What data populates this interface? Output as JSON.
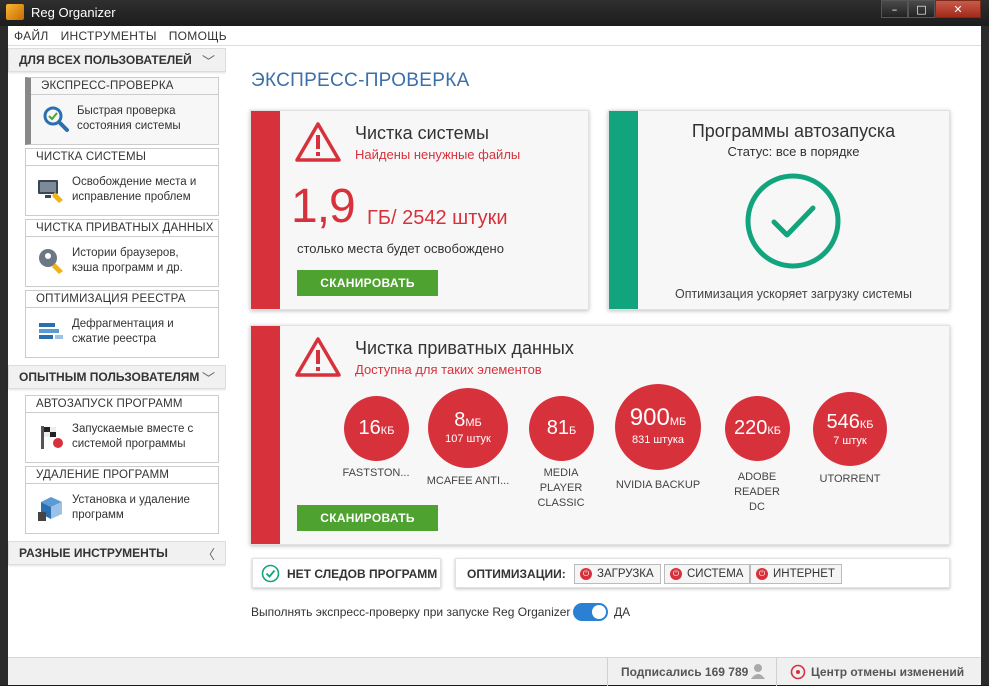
{
  "window": {
    "title": "Reg Organizer",
    "minimize": "–",
    "maximize": "□",
    "close": "✕"
  },
  "menu": [
    "ФАЙЛ",
    "ИНСТРУМЕНТЫ",
    "ПОМОЩЬ"
  ],
  "sidebar": {
    "section_all": "ДЛЯ ВСЕХ ПОЛЬЗОВАТЕЛЕЙ",
    "section_expert": "ОПЫТНЫМ ПОЛЬЗОВАТЕЛЯМ",
    "section_misc": "РАЗНЫЕ ИНСТРУМЕНТЫ",
    "items": [
      {
        "title": "ЭКСПРЕСС-ПРОВЕРКА",
        "line1": "Быстрая проверка",
        "line2": "состояния системы"
      },
      {
        "title": "ЧИСТКА СИСТЕМЫ",
        "line1": "Освобождение места и",
        "line2": "исправление проблем"
      },
      {
        "title": "ЧИСТКА ПРИВАТНЫХ ДАННЫХ",
        "line1": "Истории браузеров,",
        "line2": "кэша программ и др."
      },
      {
        "title": "ОПТИМИЗАЦИЯ РЕЕСТРА",
        "line1": "Дефрагментация и",
        "line2": "сжатие реестра"
      },
      {
        "title": "АВТОЗАПУСК ПРОГРАММ",
        "line1": "Запускаемые вместе с",
        "line2": "системой программы"
      },
      {
        "title": "УДАЛЕНИЕ ПРОГРАММ",
        "line1": "Установка и удаление",
        "line2": "программ"
      }
    ]
  },
  "main": {
    "page_title": "ЭКСПРЕСС-ПРОВЕРКА",
    "system_clean": {
      "title": "Чистка системы",
      "subtitle": "Найдены ненужные файлы",
      "amount": "1,9",
      "unit": "ГБ",
      "count": "/ 2542 штуки",
      "note": "столько места будет освобождено",
      "button": "СКАНИРОВАТЬ"
    },
    "autorun": {
      "title": "Программы автозапуска",
      "status": "Статус: все в порядке",
      "note": "Оптимизация ускоряет загрузку системы"
    },
    "private": {
      "title": "Чистка приватных данных",
      "subtitle": "Доступна для таких элементов",
      "button": "СКАНИРОВАТЬ",
      "items": [
        {
          "value": "16",
          "unit": "КБ",
          "sub": "",
          "label": "FASTSTON..."
        },
        {
          "value": "8",
          "unit": "МБ",
          "sub": "107 штук",
          "label": "MCAFEE ANTI..."
        },
        {
          "value": "81",
          "unit": "Б",
          "sub": "",
          "label": "MEDIA PLAYER CLASSIC"
        },
        {
          "value": "900",
          "unit": "МБ",
          "sub": "831 штука",
          "label": "NVIDIA BACKUP"
        },
        {
          "value": "220",
          "unit": "КБ",
          "sub": "",
          "label": "ADOBE READER DC"
        },
        {
          "value": "546",
          "unit": "КБ",
          "sub": "7 штук",
          "label": "UTORRENT"
        }
      ]
    },
    "traces": "НЕТ СЛЕДОВ ПРОГРАММ",
    "optim_label": "ОПТИМИЗАЦИИ:",
    "optim_chips": [
      "ЗАГРУЗКА",
      "СИСТЕМА",
      "ИНТЕРНЕТ"
    ],
    "autorun_check": "Выполнять экспресс-проверку при запуске Reg Organizer",
    "toggle_label": "ДА"
  },
  "footer": {
    "subscribed": "Подписались 169 789",
    "undo_center": "Центр отмены изменений"
  },
  "colors": {
    "accent_red": "#d7323c",
    "accent_green": "#12a57d",
    "button_green": "#4ea22f",
    "title_blue": "#3a6fa8",
    "toggle_blue": "#2a80d2"
  }
}
